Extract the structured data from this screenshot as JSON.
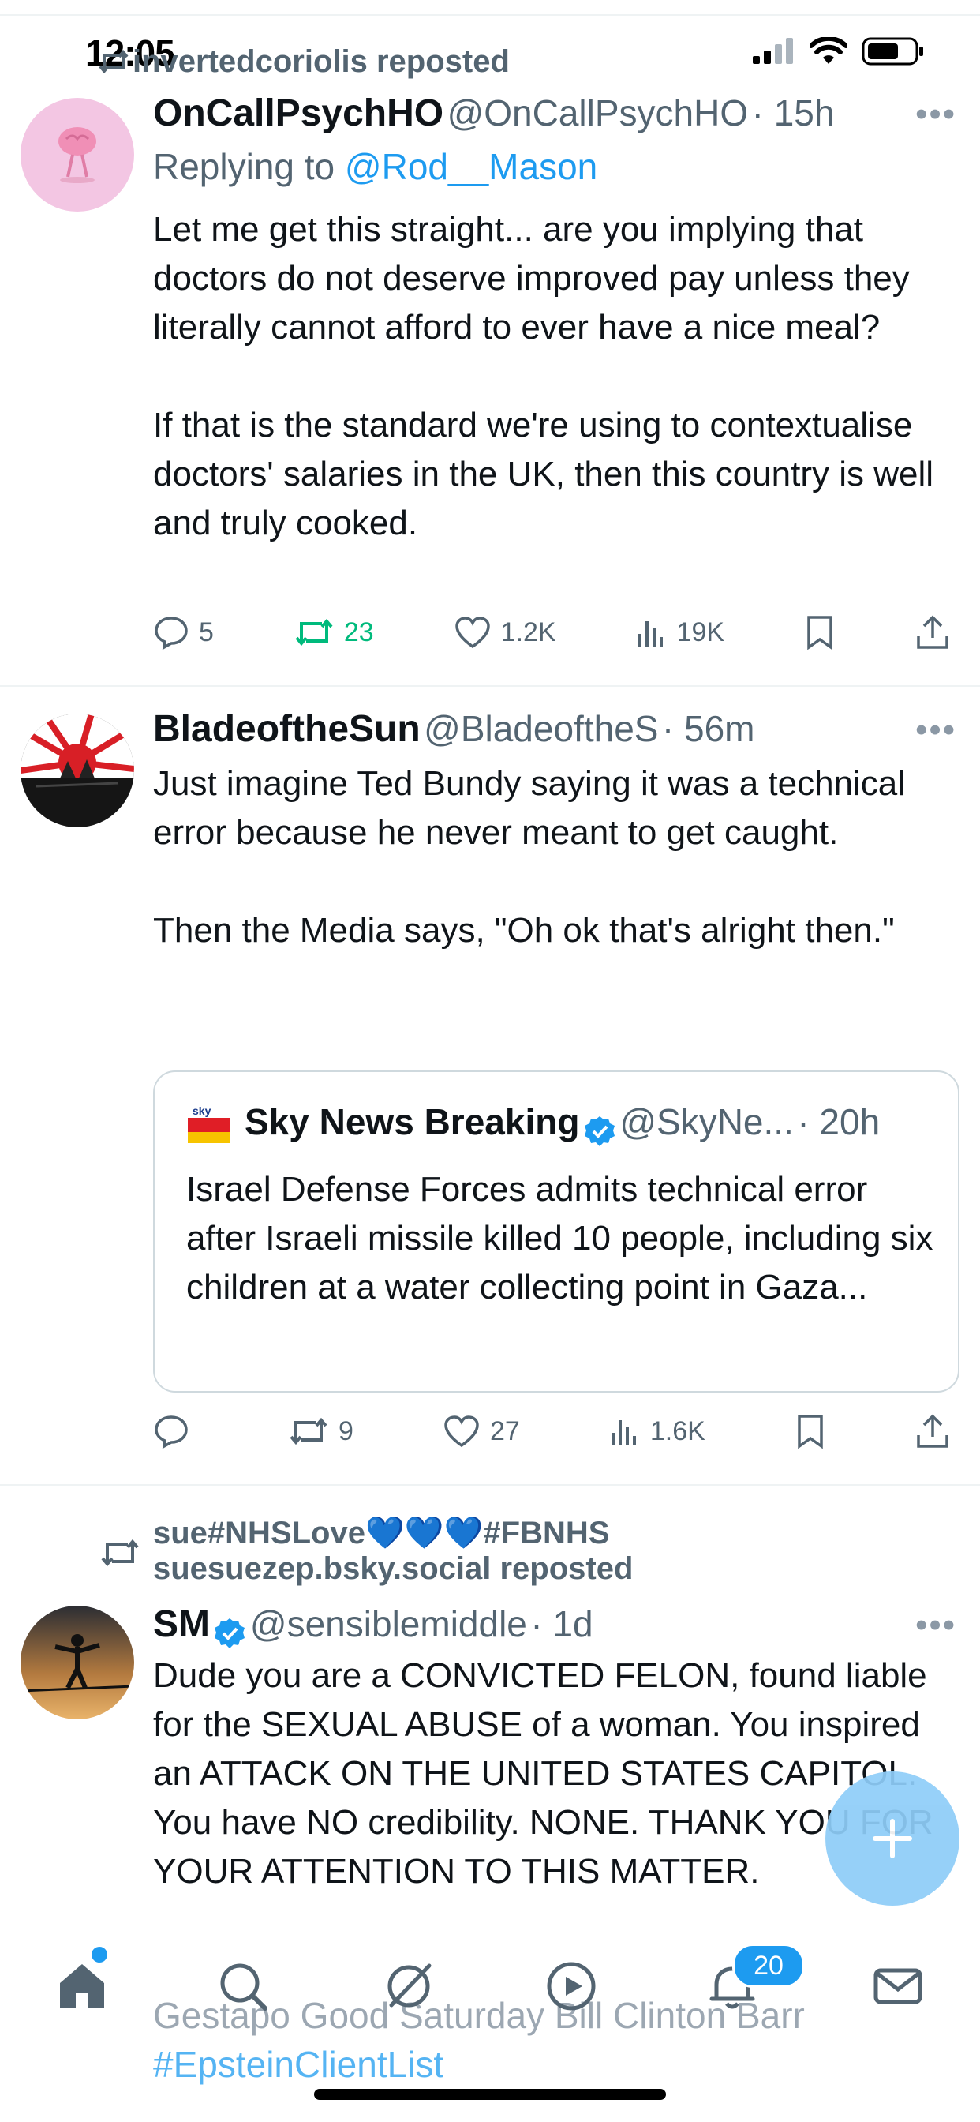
{
  "status_bar": {
    "time": "12:05"
  },
  "posts": [
    {
      "repost_by": "invertedcoriolis reposted",
      "name": "OnCallPsychHO",
      "handle": "@OnCallPsychHO",
      "time": "· 15h",
      "reply_prefix": "Replying to ",
      "reply_handle": "@Rod__Mason",
      "paragraphs": [
        "Let me get this straight... are you implying that doctors do not deserve improved pay unless they literally cannot afford to ever have a nice meal?",
        "If that is the standard we're using to contextualise doctors' salaries in the UK, then this country is well and truly cooked."
      ],
      "replies": "5",
      "reposts": "23",
      "likes": "1.2K",
      "views": "19K"
    },
    {
      "name": "BladeoftheSun",
      "handle": "@BladeoftheS",
      "time": "· 56m",
      "paragraphs": [
        "Just imagine Ted Bundy saying it was a technical error because he never meant to get caught.",
        "Then the Media says, \"Oh ok that's alright then.\""
      ],
      "quote": {
        "logo_text": "sky news breaking",
        "name": "Sky News Breaking",
        "handle": "@SkyNe...",
        "time": "· 20h",
        "text": "Israel Defense Forces admits technical error after Israeli missile killed 10 people, including six children at a water collecting point in Gaza..."
      },
      "replies": "",
      "reposts": "9",
      "likes": "27",
      "views": "1.6K"
    },
    {
      "repost_line1": "sue#NHSLove💙💙💙#FBNHS",
      "repost_line2": "suesuezep.bsky.social reposted",
      "name": "SM",
      "handle": "@sensiblemiddle",
      "time": "· 1d",
      "text": "Dude you are a CONVICTED FELON, found liable for the SEXUAL ABUSE of a woman. You inspired an ATTACK ON THE UNITED STATES CAPITOL. You have NO credibility. NONE. THANK YOU FOR YOUR ATTENTION TO THIS MATTER."
    }
  ],
  "ghost_trend": {
    "line1": "Gestapo Good Saturday Bill Clinton Barr",
    "line2": "#EpsteinClientList"
  },
  "tabbar": {
    "notifications_badge": "20"
  },
  "colors": {
    "accent": "#1d9bf0",
    "repost_green": "#00ba7c",
    "muted": "#536471"
  }
}
